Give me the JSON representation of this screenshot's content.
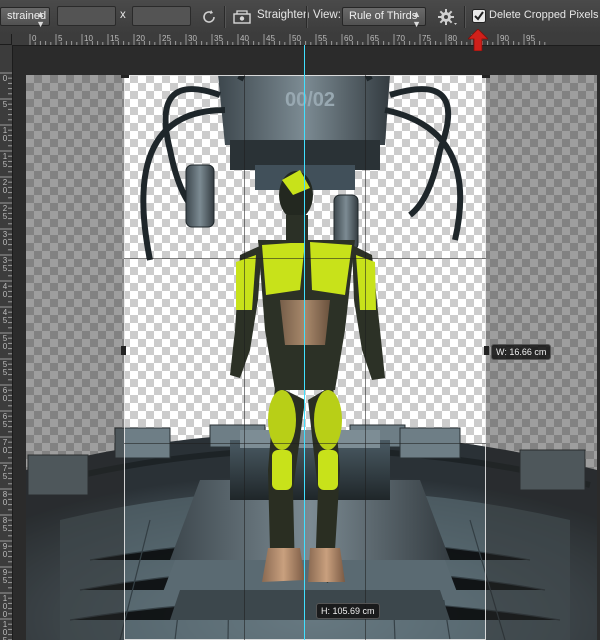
{
  "options_bar": {
    "ratio_value": "strained",
    "width_value": "",
    "times": "x",
    "height_value": "",
    "straighten_label": "Straighten",
    "view_label": "View:",
    "view_value": "Rule of Thirds",
    "delete_cropped_label": "Delete Cropped Pixels",
    "delete_cropped_checked": true
  },
  "ruler": {
    "horizontal": [
      "0",
      "5",
      "10",
      "15",
      "20",
      "25",
      "30",
      "35",
      "40",
      "45",
      "50",
      "55",
      "60",
      "65",
      "70",
      "75",
      "80",
      "85",
      "90",
      "95"
    ],
    "vertical": [
      "0",
      "5",
      "10",
      "15",
      "20",
      "25",
      "30",
      "35",
      "40",
      "45",
      "50",
      "55",
      "60",
      "65",
      "70",
      "75",
      "80",
      "85",
      "90",
      "95",
      "100",
      "105"
    ]
  },
  "canvas": {
    "device_label": "00/02",
    "width_tip": "W: 16.66 cm",
    "height_tip": "H: 105.69 cm"
  },
  "icons": [
    "rotate-icon",
    "straighten-icon",
    "gear-icon",
    "checkbox-icon",
    "red-arrow-icon"
  ],
  "colors": {
    "guide": "#40e0ff",
    "suit_accent": "#c8e21a",
    "arrow": "#d0201a"
  }
}
